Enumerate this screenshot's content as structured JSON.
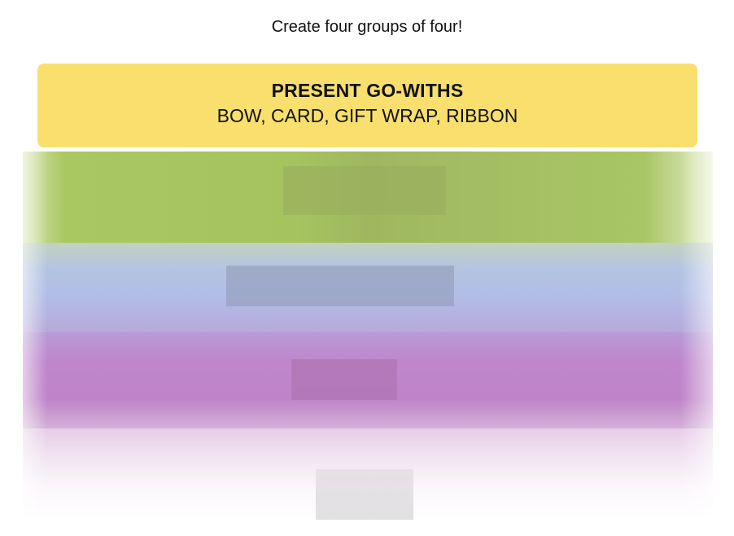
{
  "instructions": "Create four groups of four!",
  "solved_groups": [
    {
      "title": "PRESENT GO-WITHS",
      "members": "BOW, CARD, GIFT WRAP, RIBBON",
      "color": "#f9df6d"
    }
  ],
  "board": {
    "state": "obscured",
    "band_colors": [
      "#a0c35a",
      "#b0c4ef",
      "#ba81c5"
    ]
  }
}
